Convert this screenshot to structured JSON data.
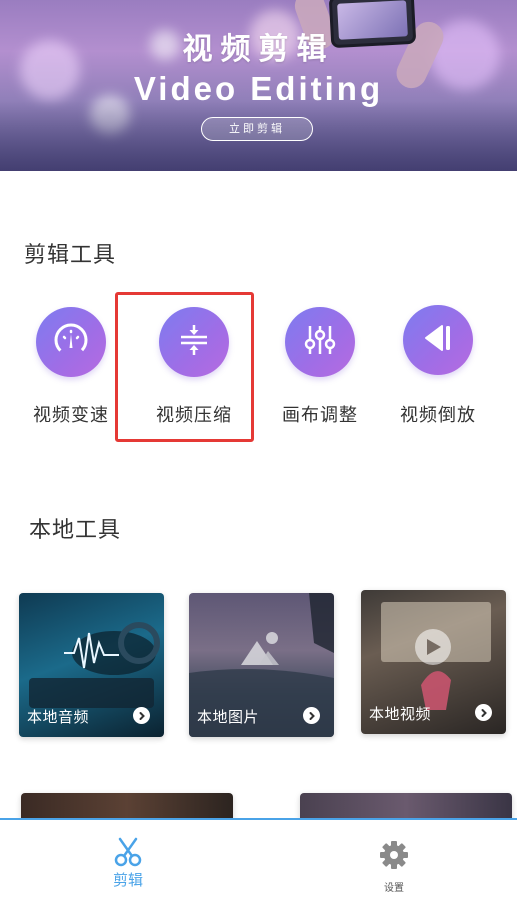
{
  "banner": {
    "title": "视频剪辑",
    "subtitle": "Video Editing",
    "button_label": "立即剪辑"
  },
  "edit_tools": {
    "title": "剪辑工具",
    "items": [
      {
        "label": "视频变速",
        "icon": "speedometer-icon"
      },
      {
        "label": "视频压缩",
        "icon": "compress-icon"
      },
      {
        "label": "画布调整",
        "icon": "sliders-icon"
      },
      {
        "label": "视频倒放",
        "icon": "rewind-icon"
      }
    ]
  },
  "local_tools": {
    "title": "本地工具",
    "items": [
      {
        "label": "本地音频",
        "icon": "chevron-right-icon"
      },
      {
        "label": "本地图片",
        "icon": "chevron-right-icon"
      },
      {
        "label": "本地视频",
        "icon": "chevron-right-icon"
      }
    ]
  },
  "tabbar": {
    "items": [
      {
        "label": "剪辑",
        "icon": "scissors-icon",
        "active": true
      },
      {
        "label": "设置",
        "icon": "gear-icon",
        "active": false
      }
    ]
  },
  "colors": {
    "accent": "#4aa3e8",
    "tool_gradient_start": "#7d7cf0",
    "tool_gradient_end": "#b66be0",
    "highlight": "#e53935"
  }
}
